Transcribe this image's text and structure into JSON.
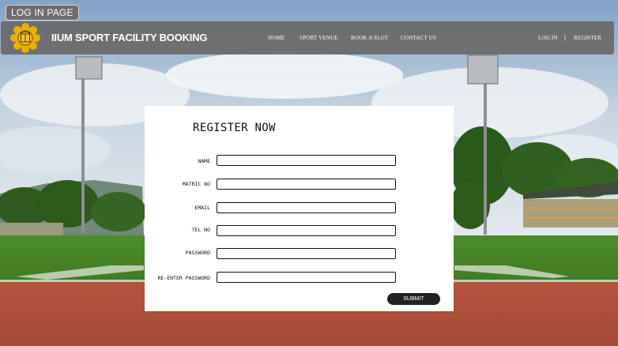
{
  "page_tag": "LOG IN PAGE",
  "header": {
    "brand": "IIUM SPORT FACILITY BOOKING",
    "nav": [
      "HOME",
      "SPORT VENUE",
      "BOOK A SLOT",
      "CONTACT US"
    ],
    "auth": {
      "login": "LOG IN",
      "separator": "|",
      "register": "REGISTER"
    }
  },
  "form": {
    "title": "REGISTER NOW",
    "fields": [
      {
        "label": "NAME",
        "value": ""
      },
      {
        "label": "MATRIC NO",
        "value": ""
      },
      {
        "label": "EMAIL",
        "value": ""
      },
      {
        "label": "TEL NO",
        "value": ""
      },
      {
        "label": "PASSWORD",
        "value": ""
      },
      {
        "label": "RE-ENTER PASSWORD",
        "value": ""
      }
    ],
    "submit_label": "SUBMIT"
  },
  "colors": {
    "header_bg": "#696969",
    "button_bg": "#222222",
    "logo_gold": "#e8b200"
  }
}
